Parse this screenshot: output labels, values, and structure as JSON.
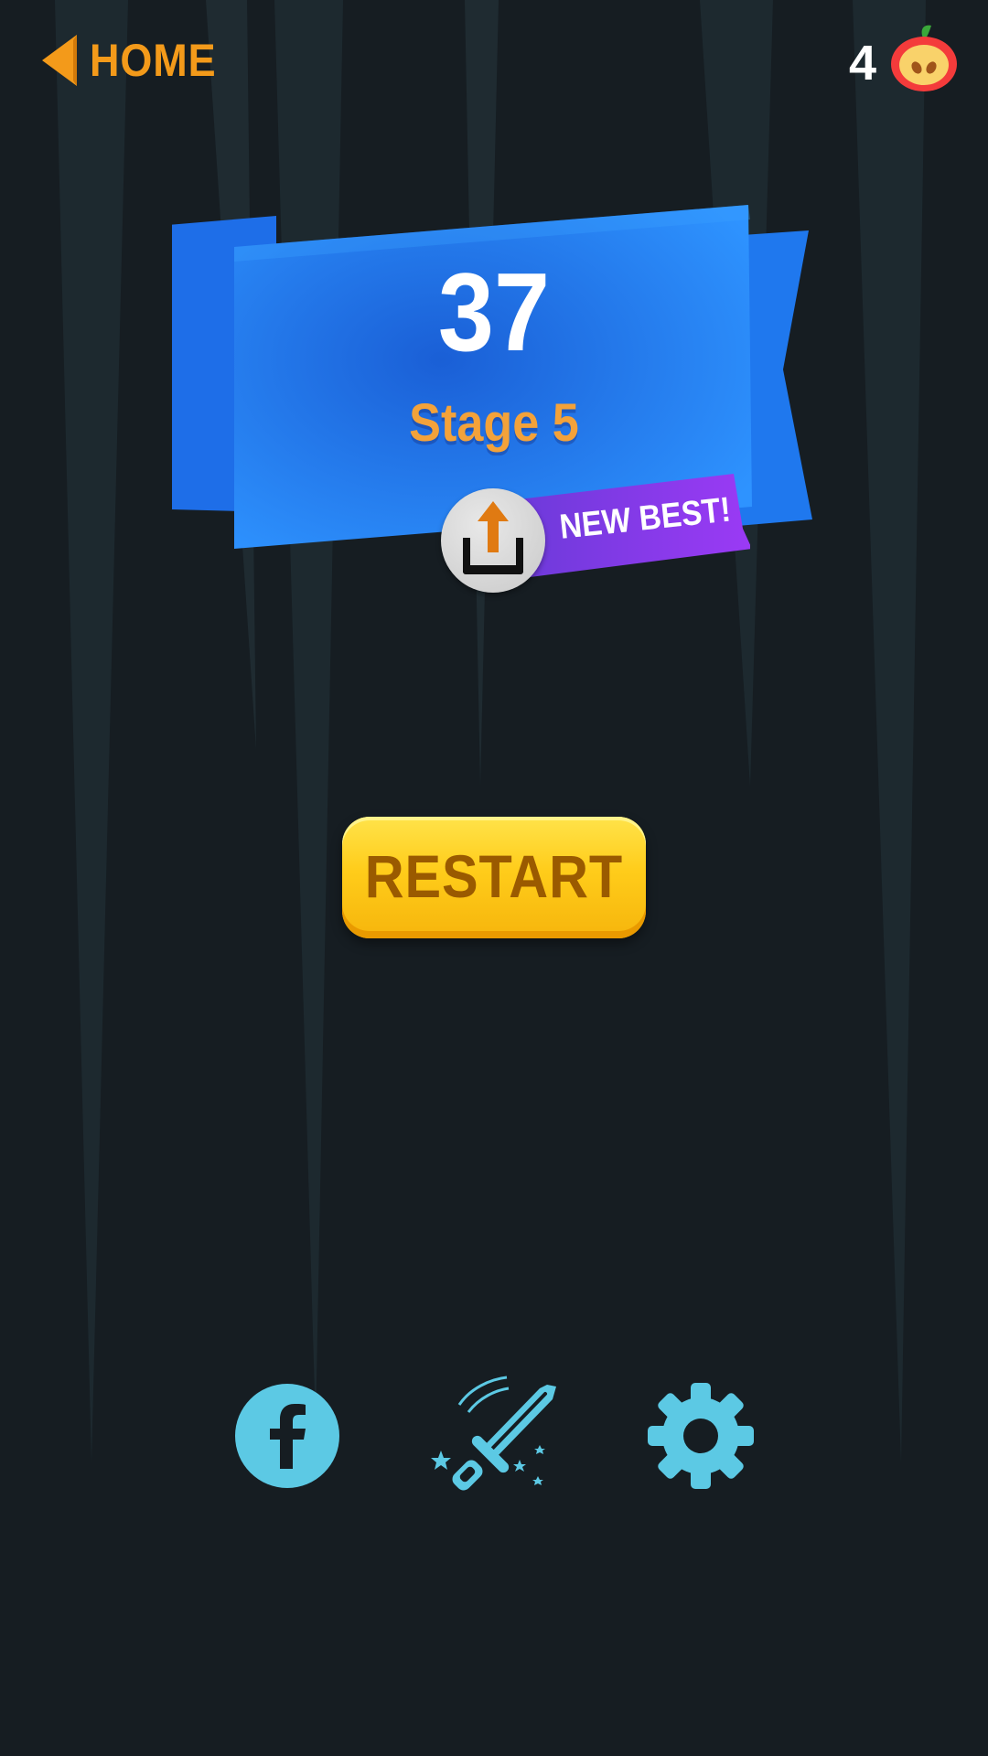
{
  "header": {
    "home_label": "HOME",
    "apple_count": "4"
  },
  "result": {
    "score": "37",
    "stage": "Stage 5",
    "new_best_label": "NEW BEST!"
  },
  "actions": {
    "restart_label": "RESTART"
  },
  "icons": {
    "back": "chevron-left-icon",
    "apple": "apple-icon",
    "share": "share-icon",
    "facebook": "facebook-icon",
    "sword": "sword-icon",
    "settings": "gear-icon"
  },
  "colors": {
    "background": "#161d22",
    "accent_orange": "#f39a1a",
    "banner_blue": "#2b8cf5",
    "new_best_purple": "#8a3af0",
    "restart_yellow": "#ffcc1a",
    "icon_cyan": "#5cc9e4"
  }
}
